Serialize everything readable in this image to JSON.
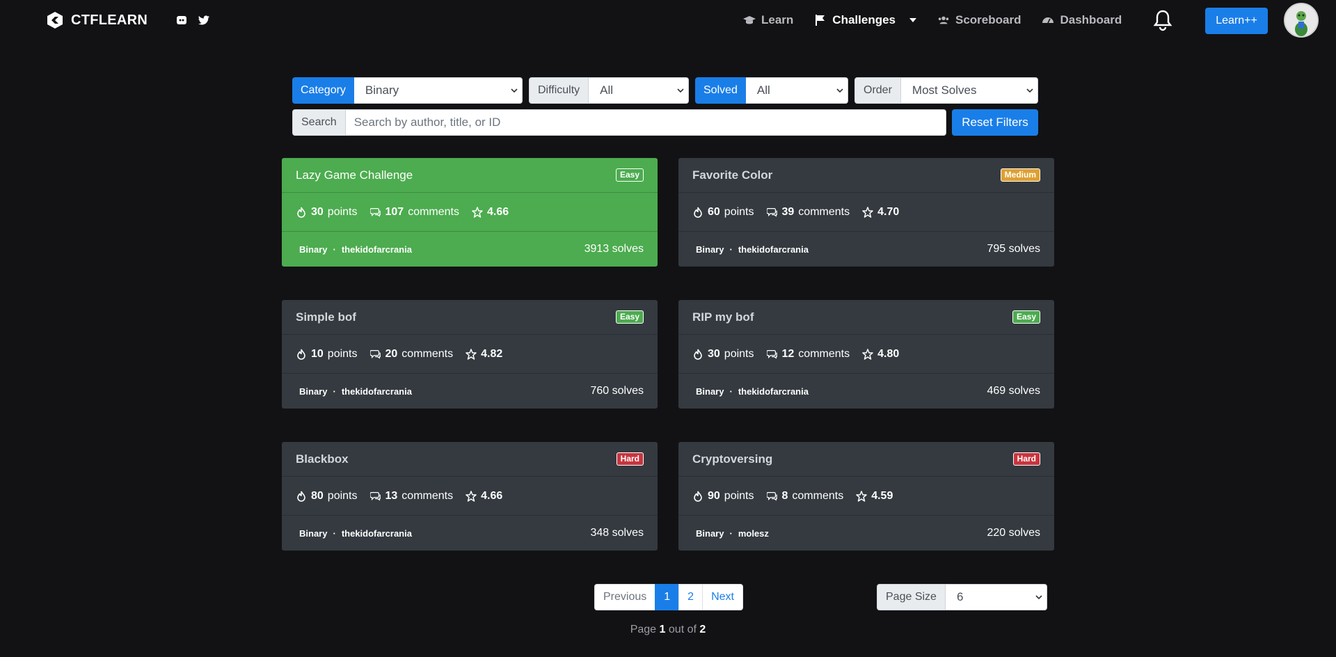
{
  "nav": {
    "brand": "CTFLEARN",
    "links": [
      {
        "label": "Learn",
        "icon": "graduation-cap-icon"
      },
      {
        "label": "Challenges",
        "icon": "flag-icon"
      },
      {
        "label": "Scoreboard",
        "icon": "users-icon"
      },
      {
        "label": "Dashboard",
        "icon": "gauge-icon"
      }
    ],
    "learn_plus": "Learn++"
  },
  "filters": {
    "category_label": "Category",
    "category_value": "Binary",
    "difficulty_label": "Difficulty",
    "difficulty_value": "All",
    "solved_label": "Solved",
    "solved_value": "All",
    "order_label": "Order",
    "order_value": "Most Solves",
    "search_label": "Search",
    "search_placeholder": "Search by author, title, or ID",
    "reset_label": "Reset Filters"
  },
  "challenges": [
    {
      "title": "Lazy Game Challenge",
      "difficulty": "Easy",
      "points": "30",
      "points_label": "points",
      "comments": "107",
      "comments_label": "comments",
      "rating": "4.66",
      "category": "Binary",
      "author": "thekidofarcrania",
      "solves": "3913 solves"
    },
    {
      "title": "Favorite Color",
      "difficulty": "Medium",
      "points": "60",
      "points_label": "points",
      "comments": "39",
      "comments_label": "comments",
      "rating": "4.70",
      "category": "Binary",
      "author": "thekidofarcrania",
      "solves": "795 solves"
    },
    {
      "title": "Simple bof",
      "difficulty": "Easy",
      "points": "10",
      "points_label": "points",
      "comments": "20",
      "comments_label": "comments",
      "rating": "4.82",
      "category": "Binary",
      "author": "thekidofarcrania",
      "solves": "760 solves"
    },
    {
      "title": "RIP my bof",
      "difficulty": "Easy",
      "points": "30",
      "points_label": "points",
      "comments": "12",
      "comments_label": "comments",
      "rating": "4.80",
      "category": "Binary",
      "author": "thekidofarcrania",
      "solves": "469 solves"
    },
    {
      "title": "Blackbox",
      "difficulty": "Hard",
      "points": "80",
      "points_label": "points",
      "comments": "13",
      "comments_label": "comments",
      "rating": "4.66",
      "category": "Binary",
      "author": "thekidofarcrania",
      "solves": "348 solves"
    },
    {
      "title": "Cryptoversing",
      "difficulty": "Hard",
      "points": "90",
      "points_label": "points",
      "comments": "8",
      "comments_label": "comments",
      "rating": "4.59",
      "category": "Binary",
      "author": "molesz",
      "solves": "220 solves"
    }
  ],
  "pagination": {
    "previous": "Previous",
    "pages": [
      "1",
      "2"
    ],
    "next": "Next",
    "page_size_label": "Page Size",
    "page_size_value": "6",
    "info_prefix": "Page",
    "current": "1",
    "info_mid": "out of",
    "total": "2"
  },
  "colors": {
    "accent": "#1a7ee8",
    "card_bg": "#343a40",
    "card_solved": "#4cac4f",
    "easy": "#4cac4f",
    "medium": "#e0a030",
    "hard": "#c9353f"
  }
}
